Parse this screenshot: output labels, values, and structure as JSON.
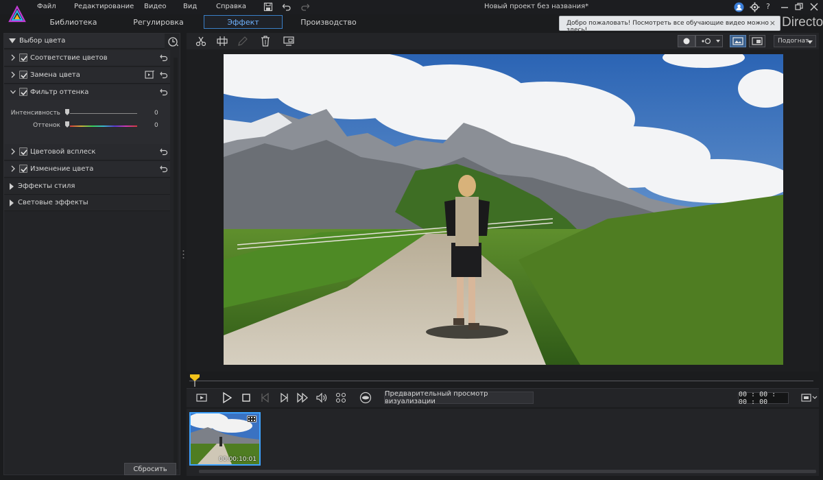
{
  "menu": {
    "items": [
      "Файл",
      "Редактирование",
      "Видео",
      "Вид",
      "Справка"
    ],
    "title": "Новый проект без названия*",
    "help": "?"
  },
  "tabs": [
    "Библиотека",
    "Регулировка",
    "Эффект",
    "Производство"
  ],
  "active_tab": "Эффект",
  "welcome": {
    "text": "Добро пожаловать! Посмотреть все обучающие видео можно здесь!",
    "close": "×"
  },
  "brand": "Director",
  "left_panel": {
    "header": "Выбор цвета",
    "rows": [
      {
        "label": "Соответствие цветов",
        "checked": true,
        "expanded": false
      },
      {
        "label": "Замена цвета",
        "checked": true,
        "expanded": false
      },
      {
        "label": "Фильтр оттенка",
        "checked": true,
        "expanded": true
      },
      {
        "label": "Цветовой всплеск",
        "checked": true,
        "expanded": false
      },
      {
        "label": "Изменение цвета",
        "checked": true,
        "expanded": false
      }
    ],
    "sliders": [
      {
        "label": "Интенсивность",
        "value": "0"
      },
      {
        "label": "Оттенок",
        "value": "0"
      }
    ],
    "sections": [
      "Эффекты стиля",
      "Световые эффекты"
    ],
    "reset_label": "Сбросить"
  },
  "preview": {
    "fit_value": "Подогнат"
  },
  "player": {
    "render_label": "Предварительный просмотр визуализации",
    "timecode": "00 : 00 : 00 : 00"
  },
  "library": {
    "clip_duration": "00:00:10:01"
  },
  "colors": {
    "accent": "#3ea3ff",
    "active_tab_text": "#6fb3ff",
    "playhead": "#f2c21a"
  }
}
